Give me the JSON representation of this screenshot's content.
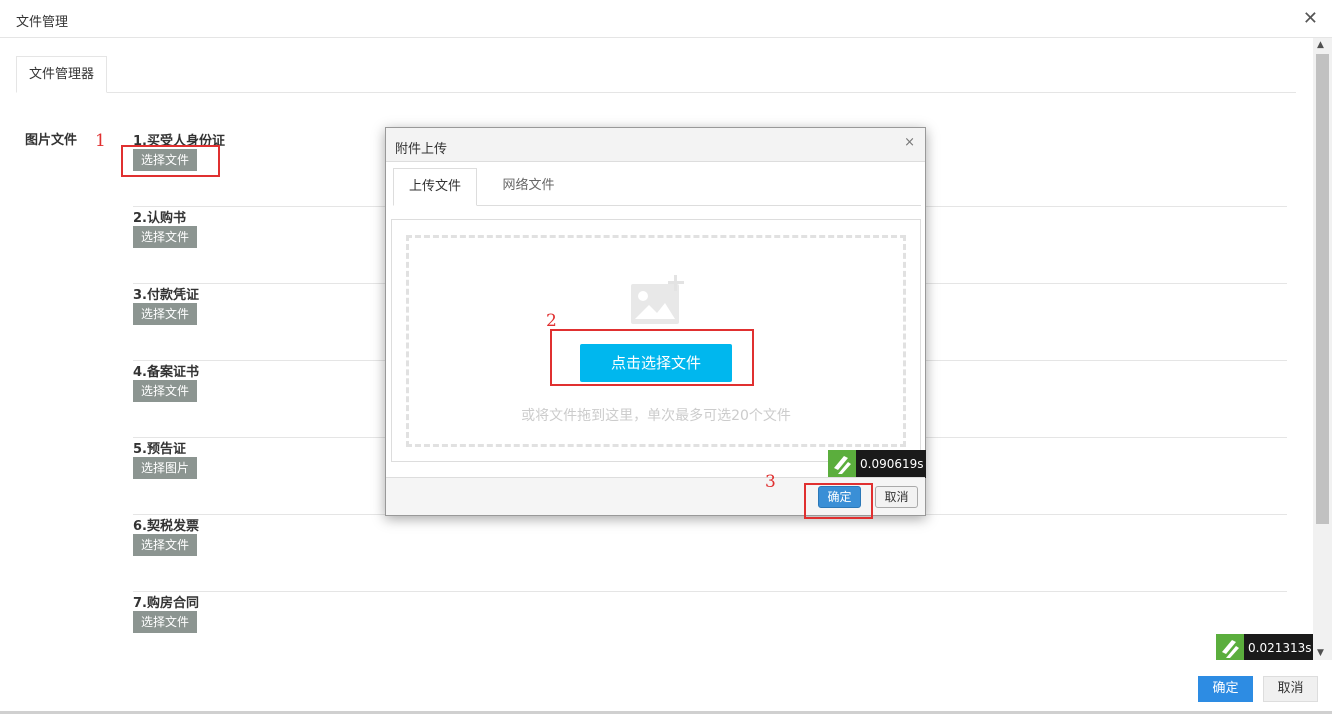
{
  "window": {
    "title": "文件管理",
    "close_glyph": "✕"
  },
  "tabs": {
    "active": "文件管理器"
  },
  "section": {
    "label": "图片文件"
  },
  "items": [
    {
      "title": "1.买受人身份证",
      "button": "选择文件"
    },
    {
      "title": "2.认购书",
      "button": "选择文件"
    },
    {
      "title": "3.付款凭证",
      "button": "选择文件"
    },
    {
      "title": "4.备案证书",
      "button": "选择文件"
    },
    {
      "title": "5.预告证",
      "button": "选择图片"
    },
    {
      "title": "6.契税发票",
      "button": "选择文件"
    },
    {
      "title": "7.购房合同",
      "button": "选择文件"
    }
  ],
  "modal": {
    "title": "附件上传",
    "close_glyph": "×",
    "tabs": [
      "上传文件",
      "网络文件"
    ],
    "pick_button": "点击选择文件",
    "drop_hint": "或将文件拖到这里，单次最多可选20个文件",
    "timer": "0.090619s",
    "ok": "确定",
    "cancel": "取消"
  },
  "annotations": [
    "1",
    "2",
    "3"
  ],
  "page_timer": "0.021313s",
  "footer": {
    "ok": "确定",
    "cancel": "取消"
  },
  "colors": {
    "accent": "#00b7ee",
    "primary": "#2d8ce3",
    "annotation": "#e03030",
    "gray_button": "#8c9591"
  }
}
